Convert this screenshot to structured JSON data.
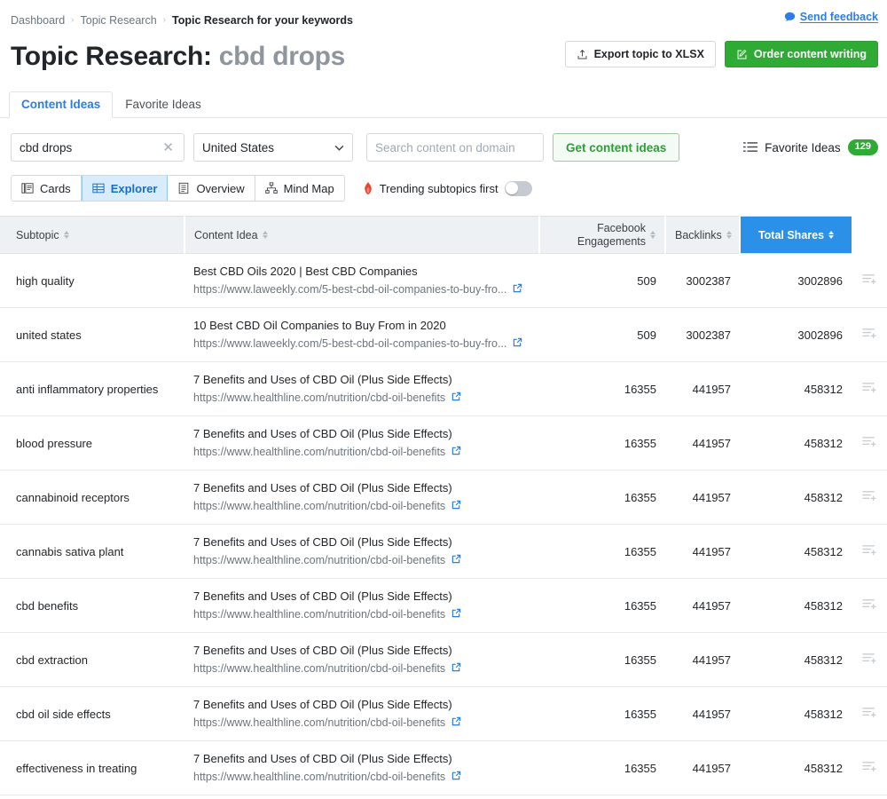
{
  "breadcrumb": {
    "items": [
      "Dashboard",
      "Topic Research",
      "Topic Research for your keywords"
    ],
    "separator": "›"
  },
  "feedback": {
    "label": "Send feedback",
    "icon": "speech-bubble-icon",
    "color": "#2b7de9"
  },
  "header": {
    "title_prefix": "Topic Research:",
    "keyword": "cbd drops",
    "export_button": {
      "label": "Export topic to XLSX",
      "icon": "upload-icon"
    },
    "order_button": {
      "label": "Order content writing",
      "icon": "edit-icon",
      "color": "#2eaa35"
    }
  },
  "tabs": [
    {
      "label": "Content Ideas",
      "active": true
    },
    {
      "label": "Favorite Ideas",
      "active": false
    }
  ],
  "filters": {
    "keyword_value": "cbd drops",
    "clear_icon": "close-icon",
    "database_value": "United States",
    "domain_placeholder": "Search content on domain",
    "domain_value": "",
    "get_ideas_label": "Get content ideas",
    "favorite_ideas_label": "Favorite Ideas",
    "favorite_ideas_count": "129",
    "favorite_ideas_icon": "list-icon"
  },
  "viewbar": {
    "modes": [
      {
        "label": "Cards",
        "icon": "cards-icon",
        "active": false
      },
      {
        "label": "Explorer",
        "icon": "table-icon",
        "active": true
      },
      {
        "label": "Overview",
        "icon": "document-icon",
        "active": false
      },
      {
        "label": "Mind Map",
        "icon": "hierarchy-icon",
        "active": false
      }
    ],
    "trending_label": "Trending subtopics first",
    "trending_icon": "flame-icon",
    "trending_on": false
  },
  "table": {
    "columns": [
      {
        "key": "subtopic",
        "label": "Subtopic",
        "sortable": true,
        "sorted": false
      },
      {
        "key": "content_idea",
        "label": "Content Idea",
        "sortable": true,
        "sorted": false
      },
      {
        "key": "facebook_engagements",
        "label_line1": "Facebook",
        "label_line2": "Engagements",
        "sortable": true,
        "sorted": false
      },
      {
        "key": "backlinks",
        "label": "Backlinks",
        "sortable": true,
        "sorted": false
      },
      {
        "key": "total_shares",
        "label": "Total Shares",
        "sortable": true,
        "sorted": true
      }
    ],
    "row_action_icon": "add-to-list-icon",
    "rows": [
      {
        "subtopic": "high quality",
        "idea_title": "Best CBD Oils 2020 | Best CBD Companies",
        "idea_url": "https://www.laweekly.com/5-best-cbd-oil-companies-to-buy-fro...",
        "facebook_engagements": "509",
        "backlinks": "3002387",
        "total_shares": "3002896"
      },
      {
        "subtopic": "united states",
        "idea_title": "10 Best CBD Oil Companies to Buy From in 2020",
        "idea_url": "https://www.laweekly.com/5-best-cbd-oil-companies-to-buy-fro...",
        "facebook_engagements": "509",
        "backlinks": "3002387",
        "total_shares": "3002896"
      },
      {
        "subtopic": "anti inflammatory properties",
        "idea_title": "7 Benefits and Uses of CBD Oil (Plus Side Effects)",
        "idea_url": "https://www.healthline.com/nutrition/cbd-oil-benefits",
        "facebook_engagements": "16355",
        "backlinks": "441957",
        "total_shares": "458312"
      },
      {
        "subtopic": "blood pressure",
        "idea_title": "7 Benefits and Uses of CBD Oil (Plus Side Effects)",
        "idea_url": "https://www.healthline.com/nutrition/cbd-oil-benefits",
        "facebook_engagements": "16355",
        "backlinks": "441957",
        "total_shares": "458312"
      },
      {
        "subtopic": "cannabinoid receptors",
        "idea_title": "7 Benefits and Uses of CBD Oil (Plus Side Effects)",
        "idea_url": "https://www.healthline.com/nutrition/cbd-oil-benefits",
        "facebook_engagements": "16355",
        "backlinks": "441957",
        "total_shares": "458312"
      },
      {
        "subtopic": "cannabis sativa plant",
        "idea_title": "7 Benefits and Uses of CBD Oil (Plus Side Effects)",
        "idea_url": "https://www.healthline.com/nutrition/cbd-oil-benefits",
        "facebook_engagements": "16355",
        "backlinks": "441957",
        "total_shares": "458312"
      },
      {
        "subtopic": "cbd benefits",
        "idea_title": "7 Benefits and Uses of CBD Oil (Plus Side Effects)",
        "idea_url": "https://www.healthline.com/nutrition/cbd-oil-benefits",
        "facebook_engagements": "16355",
        "backlinks": "441957",
        "total_shares": "458312"
      },
      {
        "subtopic": "cbd extraction",
        "idea_title": "7 Benefits and Uses of CBD Oil (Plus Side Effects)",
        "idea_url": "https://www.healthline.com/nutrition/cbd-oil-benefits",
        "facebook_engagements": "16355",
        "backlinks": "441957",
        "total_shares": "458312"
      },
      {
        "subtopic": "cbd oil side effects",
        "idea_title": "7 Benefits and Uses of CBD Oil (Plus Side Effects)",
        "idea_url": "https://www.healthline.com/nutrition/cbd-oil-benefits",
        "facebook_engagements": "16355",
        "backlinks": "441957",
        "total_shares": "458312"
      },
      {
        "subtopic": "effectiveness in treating",
        "idea_title": "7 Benefits and Uses of CBD Oil (Plus Side Effects)",
        "idea_url": "https://www.healthline.com/nutrition/cbd-oil-benefits",
        "facebook_engagements": "16355",
        "backlinks": "441957",
        "total_shares": "458312"
      }
    ]
  }
}
